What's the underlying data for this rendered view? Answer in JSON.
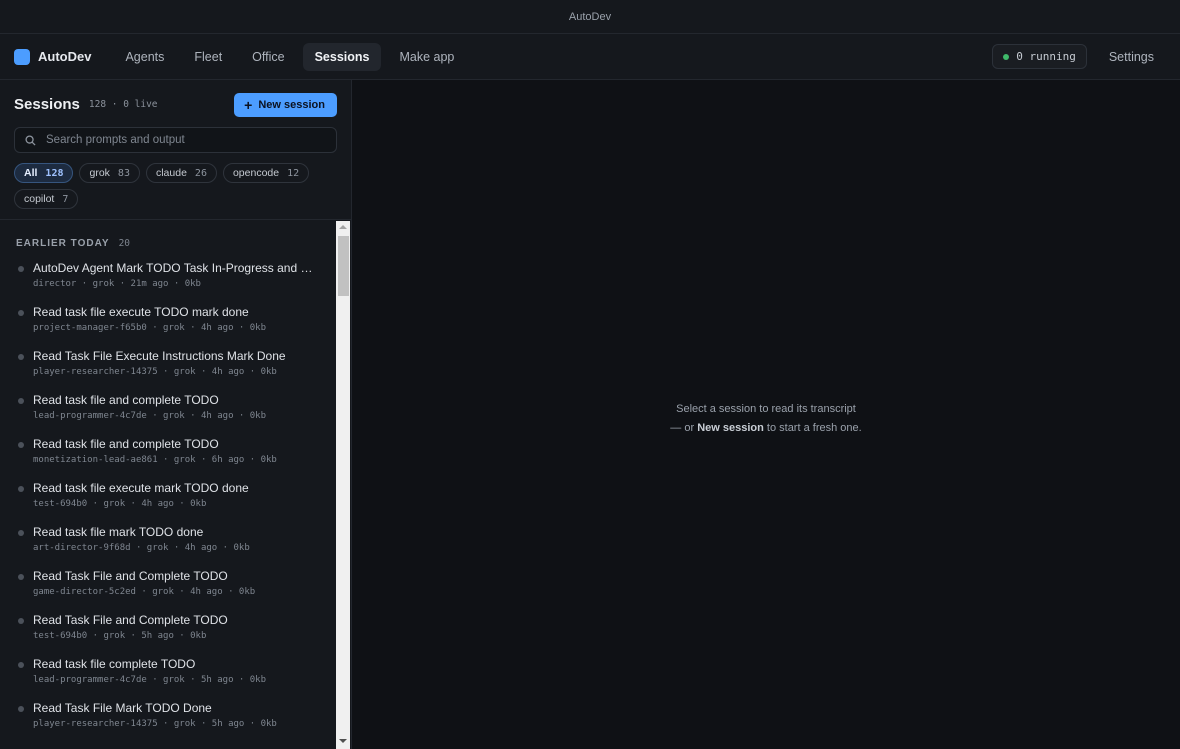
{
  "window": {
    "title": "AutoDev"
  },
  "nav": {
    "brand": "AutoDev",
    "tabs": [
      {
        "label": "Agents",
        "active": false
      },
      {
        "label": "Fleet",
        "active": false
      },
      {
        "label": "Office",
        "active": false
      },
      {
        "label": "Sessions",
        "active": true
      },
      {
        "label": "Make app",
        "active": false
      }
    ],
    "running": "0 running",
    "settings": "Settings"
  },
  "sidebar": {
    "title": "Sessions",
    "meta": "128 · 0 live",
    "new_button": "New session",
    "search_placeholder": "Search prompts and output",
    "filters": [
      {
        "label": "All",
        "count": "128",
        "active": true
      },
      {
        "label": "grok",
        "count": "83",
        "active": false
      },
      {
        "label": "claude",
        "count": "26",
        "active": false
      },
      {
        "label": "opencode",
        "count": "12",
        "active": false
      },
      {
        "label": "copilot",
        "count": "7",
        "active": false
      }
    ],
    "group": {
      "title": "EARLIER TODAY",
      "count": "20"
    },
    "items": [
      {
        "title": "AutoDev Agent Mark TODO Task In-Progress and …",
        "meta": "director · grok · 21m ago · 0kb"
      },
      {
        "title": "Read task file execute TODO mark done",
        "meta": "project-manager-f65b0 · grok · 4h ago · 0kb"
      },
      {
        "title": "Read Task File Execute Instructions Mark Done",
        "meta": "player-researcher-14375 · grok · 4h ago · 0kb"
      },
      {
        "title": "Read task file and complete TODO",
        "meta": "lead-programmer-4c7de · grok · 4h ago · 0kb"
      },
      {
        "title": "Read task file and complete TODO",
        "meta": "monetization-lead-ae861 · grok · 6h ago · 0kb"
      },
      {
        "title": "Read task file execute mark TODO done",
        "meta": "test-694b0 · grok · 4h ago · 0kb"
      },
      {
        "title": "Read task file mark TODO done",
        "meta": "art-director-9f68d · grok · 4h ago · 0kb"
      },
      {
        "title": "Read Task File and Complete TODO",
        "meta": "game-director-5c2ed · grok · 4h ago · 0kb"
      },
      {
        "title": "Read Task File and Complete TODO",
        "meta": "test-694b0 · grok · 5h ago · 0kb"
      },
      {
        "title": "Read task file complete TODO",
        "meta": "lead-programmer-4c7de · grok · 5h ago · 0kb"
      },
      {
        "title": "Read Task File Mark TODO Done",
        "meta": "player-researcher-14375 · grok · 5h ago · 0kb"
      }
    ]
  },
  "main": {
    "empty_line1": "Select a session to read its transcript",
    "empty_line2_pre": "— or",
    "empty_line2_bold": "New session",
    "empty_line2_post": "to start a fresh one."
  }
}
